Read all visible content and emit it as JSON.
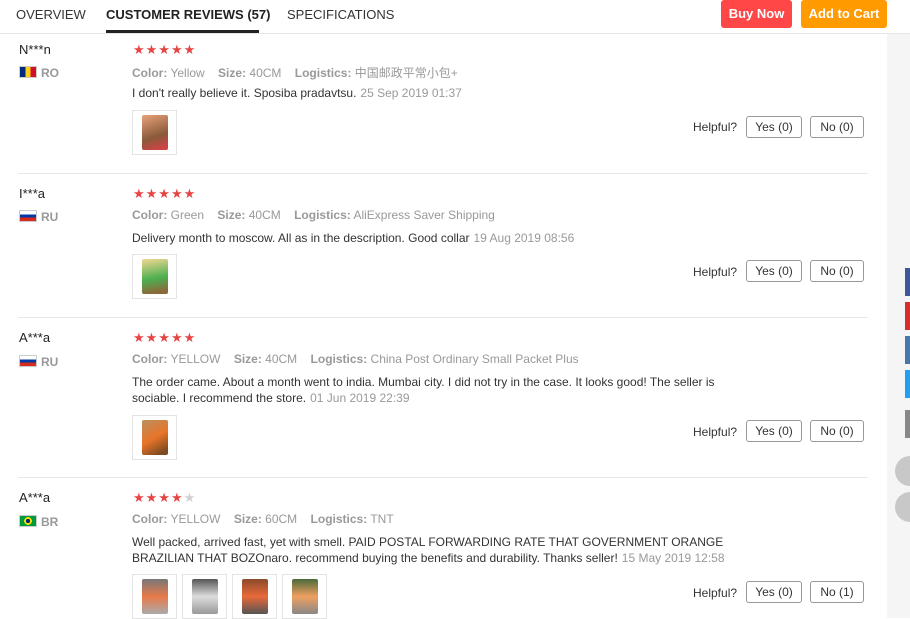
{
  "tabs": [
    {
      "label": "OVERVIEW"
    },
    {
      "label": "CUSTOMER REVIEWS (57)"
    },
    {
      "label": "SPECIFICATIONS"
    }
  ],
  "actions": {
    "buy_now": "Buy Now",
    "add_to_cart": "Add to Cart"
  },
  "labels": {
    "color": "Color:",
    "size": "Size:",
    "logistics": "Logistics:",
    "helpful": "Helpful?"
  },
  "reviews": [
    {
      "user": "N***n",
      "country": "RO",
      "stars": "★★★★★",
      "stars_off": "",
      "color": "Yellow",
      "size": "40CM",
      "logistics": "中国邮政平常小包+",
      "text": "I don't really believe it. Sposiba pradavtsu.",
      "date": "25 Sep 2019 01:37",
      "yes": "Yes (0)",
      "no": "No (0)"
    },
    {
      "user": "I***a",
      "country": "RU",
      "stars": "★★★★★",
      "stars_off": "",
      "color": "Green",
      "size": "40CM",
      "logistics": "AliExpress Saver Shipping",
      "text": "Delivery month to moscow. All as in the description. Good collar",
      "date": "19 Aug 2019 08:56",
      "yes": "Yes (0)",
      "no": "No (0)"
    },
    {
      "user": "A***a",
      "country": "RU",
      "stars": "★★★★★",
      "stars_off": "",
      "color": "YELLOW",
      "size": "40CM",
      "logistics": "China Post Ordinary Small Packet Plus",
      "text": "The order came. About a month went to india. Mumbai city. I did not try in the case. It looks good! The seller is sociable. I recommend the store.",
      "date": "01 Jun 2019 22:39",
      "yes": "Yes (0)",
      "no": "No (0)"
    },
    {
      "user": "A***a",
      "country": "BR",
      "stars": "★★★★",
      "stars_off": "★",
      "color": "YELLOW",
      "size": "60CM",
      "logistics": "TNT",
      "text": "Well packed, arrived fast, yet with smell. PAID POSTAL FORWARDING RATE THAT GOVERNMENT ORANGE BRAZILIAN THAT BOZOnaro. recommend buying the benefits and durability. Thanks seller!",
      "date": "15 May 2019 12:58",
      "yes": "Yes (0)",
      "no": "No (1)"
    }
  ]
}
